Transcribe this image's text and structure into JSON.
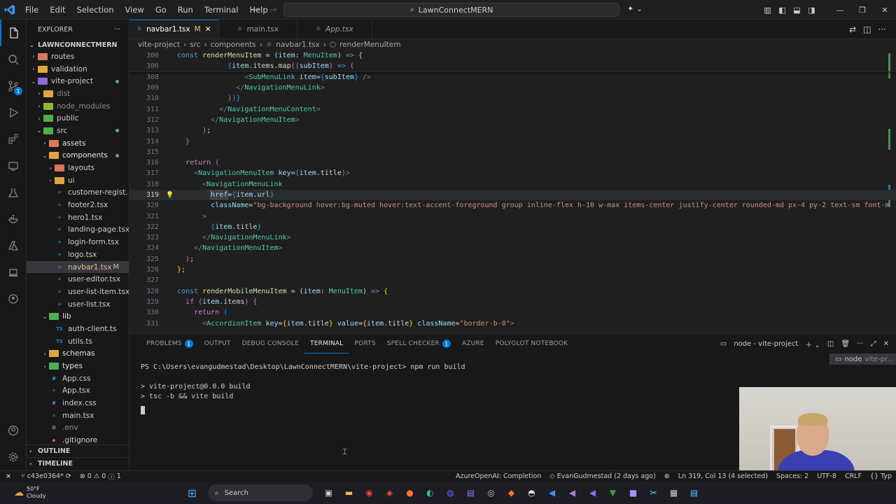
{
  "window": {
    "menu": [
      "File",
      "Edit",
      "Selection",
      "View",
      "Go",
      "Run",
      "Terminal",
      "Help"
    ],
    "search_text": "LawnConnectMERN"
  },
  "explorer": {
    "title": "EXPLORER",
    "root": "LAWNCONNECTMERN",
    "items": [
      {
        "label": "routes",
        "depth": 1,
        "type": "folder",
        "color": "#d9795a",
        "chev": "›"
      },
      {
        "label": "validation",
        "depth": 1,
        "type": "folder",
        "color": "#e0a53d",
        "chev": "›"
      },
      {
        "label": "vite-project",
        "depth": 1,
        "type": "folder",
        "color": "#8b6cdb",
        "chev": "⌄",
        "dot": true
      },
      {
        "label": "dist",
        "depth": 2,
        "type": "folder",
        "color": "#e0a53d",
        "chev": "›",
        "dim": true
      },
      {
        "label": "node_modules",
        "depth": 2,
        "type": "folder",
        "color": "#8fb23a",
        "chev": "›",
        "dim": true
      },
      {
        "label": "public",
        "depth": 2,
        "type": "folder",
        "color": "#4caf50",
        "chev": "›"
      },
      {
        "label": "src",
        "depth": 2,
        "type": "folder",
        "color": "#4caf50",
        "chev": "⌄",
        "dot": true
      },
      {
        "label": "assets",
        "depth": 3,
        "type": "folder",
        "color": "#d9795a",
        "chev": "›"
      },
      {
        "label": "components",
        "depth": 3,
        "type": "folder",
        "color": "#e0a53d",
        "chev": "⌄",
        "dot": true
      },
      {
        "label": "layouts",
        "depth": 4,
        "type": "folder",
        "color": "#d9795a",
        "chev": "›"
      },
      {
        "label": "ui",
        "depth": 4,
        "type": "folder",
        "color": "#e0a53d",
        "chev": "›"
      },
      {
        "label": "customer-regist...",
        "depth": 4,
        "type": "react"
      },
      {
        "label": "footer2.tsx",
        "depth": 4,
        "type": "react"
      },
      {
        "label": "hero1.tsx",
        "depth": 4,
        "type": "react"
      },
      {
        "label": "landing-page.tsx",
        "depth": 4,
        "type": "react"
      },
      {
        "label": "login-form.tsx",
        "depth": 4,
        "type": "react"
      },
      {
        "label": "logo.tsx",
        "depth": 4,
        "type": "react"
      },
      {
        "label": "navbar1.tsx",
        "depth": 4,
        "type": "react",
        "selected": true,
        "mod": "M"
      },
      {
        "label": "user-editor.tsx",
        "depth": 4,
        "type": "react"
      },
      {
        "label": "user-list-item.tsx",
        "depth": 4,
        "type": "react"
      },
      {
        "label": "user-list.tsx",
        "depth": 4,
        "type": "react"
      },
      {
        "label": "lib",
        "depth": 3,
        "type": "folder",
        "color": "#4caf50",
        "chev": "⌄"
      },
      {
        "label": "auth-client.ts",
        "depth": 4,
        "type": "ts"
      },
      {
        "label": "utils.ts",
        "depth": 4,
        "type": "ts"
      },
      {
        "label": "schemas",
        "depth": 3,
        "type": "folder",
        "color": "#e0a53d",
        "chev": "›"
      },
      {
        "label": "types",
        "depth": 3,
        "type": "folder",
        "color": "#4caf50",
        "chev": "›"
      },
      {
        "label": "App.css",
        "depth": 3,
        "type": "css"
      },
      {
        "label": "App.tsx",
        "depth": 3,
        "type": "react"
      },
      {
        "label": "index.css",
        "depth": 3,
        "type": "css"
      },
      {
        "label": "main.tsx",
        "depth": 3,
        "type": "react"
      },
      {
        "label": ".env",
        "depth": 3,
        "type": "env",
        "dim": true
      },
      {
        "label": ".gitignore",
        "depth": 3,
        "type": "git"
      }
    ],
    "sections": [
      "OUTLINE",
      "TIMELINE"
    ]
  },
  "tabs": [
    {
      "label": "navbar1.tsx",
      "suffix": "M",
      "active": true
    },
    {
      "label": "main.tsx"
    },
    {
      "label": "App.tsx",
      "italic": true
    }
  ],
  "breadcrumb": [
    "vite-project",
    "src",
    "components",
    "navbar1.tsx",
    "renderMenuItem"
  ],
  "code": [
    {
      "ln": "300",
      "sticky": true,
      "tokens": [
        [
          "kw",
          "const "
        ],
        [
          "fn",
          "renderMenuItem"
        ],
        [
          "",
          " = ("
        ],
        [
          "attr",
          "item"
        ],
        [
          "",
          ": "
        ],
        [
          "tag",
          "MenuItem"
        ],
        [
          "",
          ") "
        ],
        [
          "kw",
          "=>"
        ],
        [
          "",
          " {"
        ]
      ]
    },
    {
      "ln": "306",
      "sticky": true,
      "tokens": [
        [
          "",
          "            "
        ],
        [
          "br3",
          "{"
        ],
        [
          "attr",
          "item"
        ],
        [
          "",
          ".items."
        ],
        [
          "fn",
          "map"
        ],
        [
          "br2",
          "(("
        ],
        [
          "attr",
          "subItem"
        ],
        [
          "br2",
          ")"
        ],
        [
          "kw",
          " =>"
        ],
        [
          "br2",
          " ("
        ]
      ]
    },
    {
      "ln": "308",
      "tokens": [
        [
          "",
          "                "
        ],
        [
          "pun",
          "<"
        ],
        [
          "tag",
          "SubMenuLink"
        ],
        [
          "attr",
          " item"
        ],
        [
          "",
          "="
        ],
        [
          "br3",
          "{"
        ],
        [
          "attr",
          "subItem"
        ],
        [
          "br3",
          "}"
        ],
        [
          "pun",
          " />"
        ]
      ]
    },
    {
      "ln": "309",
      "tokens": [
        [
          "",
          "              "
        ],
        [
          "pun",
          "</"
        ],
        [
          "tag",
          "NavigationMenuLink"
        ],
        [
          "pun",
          ">"
        ]
      ]
    },
    {
      "ln": "310",
      "tokens": [
        [
          "",
          "            "
        ],
        [
          "br2",
          ")"
        ],
        [
          "br3",
          ")"
        ],
        [
          "br3",
          "}"
        ]
      ]
    },
    {
      "ln": "311",
      "tokens": [
        [
          "",
          "          "
        ],
        [
          "pun",
          "</"
        ],
        [
          "tag",
          "NavigationMenuContent"
        ],
        [
          "pun",
          ">"
        ]
      ]
    },
    {
      "ln": "312",
      "tokens": [
        [
          "",
          "        "
        ],
        [
          "pun",
          "</"
        ],
        [
          "tag",
          "NavigationMenuItem"
        ],
        [
          "pun",
          ">"
        ]
      ]
    },
    {
      "ln": "313",
      "tokens": [
        [
          "",
          "      "
        ],
        [
          "br2",
          ")"
        ],
        [
          "",
          ";"
        ]
      ]
    },
    {
      "ln": "314",
      "tokens": [
        [
          "",
          "  "
        ],
        [
          "br2",
          "}"
        ]
      ]
    },
    {
      "ln": "315",
      "tokens": [
        [
          "",
          ""
        ]
      ]
    },
    {
      "ln": "316",
      "tokens": [
        [
          "",
          "  "
        ],
        [
          "ctl",
          "return"
        ],
        [
          "br2",
          " ("
        ]
      ]
    },
    {
      "ln": "317",
      "tokens": [
        [
          "",
          "    "
        ],
        [
          "pun",
          "<"
        ],
        [
          "tag",
          "NavigationMenuItem"
        ],
        [
          "attr",
          " key"
        ],
        [
          "",
          "="
        ],
        [
          "br3",
          "{"
        ],
        [
          "attr",
          "item"
        ],
        [
          "",
          ".title"
        ],
        [
          "br3",
          "}"
        ],
        [
          "pun",
          ">"
        ]
      ]
    },
    {
      "ln": "318",
      "tokens": [
        [
          "",
          "      "
        ],
        [
          "pun",
          "<"
        ],
        [
          "tag",
          "NavigationMenuLink"
        ]
      ]
    },
    {
      "ln": "319",
      "hl": true,
      "tokens": [
        [
          "",
          "        "
        ],
        [
          "attr",
          "href"
        ],
        [
          "",
          "="
        ],
        [
          "br3",
          "{"
        ],
        [
          "attr",
          "item"
        ],
        [
          "",
          ".url"
        ],
        [
          "br3",
          "}"
        ]
      ]
    },
    {
      "ln": "320",
      "tokens": [
        [
          "",
          "        "
        ],
        [
          "attr",
          "className"
        ],
        [
          "",
          "="
        ],
        [
          "str",
          "\"bg-background hover:bg-muted hover:text-accent-foreground group inline-flex h-10 w-max items-center justify-center rounded-md px-4 py-2 text-sm font-m"
        ]
      ]
    },
    {
      "ln": "321",
      "tokens": [
        [
          "",
          "      "
        ],
        [
          "pun",
          ">"
        ]
      ]
    },
    {
      "ln": "322",
      "tokens": [
        [
          "",
          "        "
        ],
        [
          "br3",
          "{"
        ],
        [
          "attr",
          "item"
        ],
        [
          "",
          ".title"
        ],
        [
          "br3",
          "}"
        ]
      ]
    },
    {
      "ln": "323",
      "tokens": [
        [
          "",
          "      "
        ],
        [
          "pun",
          "</"
        ],
        [
          "tag",
          "NavigationMenuLink"
        ],
        [
          "pun",
          ">"
        ]
      ]
    },
    {
      "ln": "324",
      "tokens": [
        [
          "",
          "    "
        ],
        [
          "pun",
          "</"
        ],
        [
          "tag",
          "NavigationMenuItem"
        ],
        [
          "pun",
          ">"
        ]
      ]
    },
    {
      "ln": "325",
      "tokens": [
        [
          "",
          "  "
        ],
        [
          "br2",
          ")"
        ],
        [
          "",
          ";"
        ]
      ]
    },
    {
      "ln": "326",
      "tokens": [
        [
          "br",
          "}"
        ],
        [
          "",
          ";"
        ]
      ]
    },
    {
      "ln": "327",
      "tokens": [
        [
          "",
          ""
        ]
      ]
    },
    {
      "ln": "328",
      "tokens": [
        [
          "kw",
          "const "
        ],
        [
          "fn",
          "renderMobileMenuItem"
        ],
        [
          "",
          " = ("
        ],
        [
          "attr",
          "item"
        ],
        [
          "",
          ": "
        ],
        [
          "tag",
          "MenuItem"
        ],
        [
          "",
          ") "
        ],
        [
          "kw",
          "=>"
        ],
        [
          "",
          " "
        ],
        [
          "br",
          "{"
        ]
      ]
    },
    {
      "ln": "329",
      "tokens": [
        [
          "",
          "  "
        ],
        [
          "ctl",
          "if"
        ],
        [
          "br2",
          " ("
        ],
        [
          "attr",
          "item"
        ],
        [
          "",
          ".items"
        ],
        [
          "br2",
          ")"
        ],
        [
          "",
          " "
        ],
        [
          "br2",
          "{"
        ]
      ]
    },
    {
      "ln": "330",
      "tokens": [
        [
          "",
          "    "
        ],
        [
          "ctl",
          "return"
        ],
        [
          "br3",
          " ("
        ]
      ]
    },
    {
      "ln": "331",
      "tokens": [
        [
          "",
          "      "
        ],
        [
          "pun",
          "<"
        ],
        [
          "tag",
          "AccordionItem"
        ],
        [
          "attr",
          " key"
        ],
        [
          "",
          "="
        ],
        [
          "br",
          "{"
        ],
        [
          "attr",
          "item"
        ],
        [
          "",
          ".title"
        ],
        [
          "br",
          "}"
        ],
        [
          "attr",
          " value"
        ],
        [
          "",
          "="
        ],
        [
          "br",
          "{"
        ],
        [
          "attr",
          "item"
        ],
        [
          "",
          ".title"
        ],
        [
          "br",
          "}"
        ],
        [
          "attr",
          " className"
        ],
        [
          "",
          "="
        ],
        [
          "str",
          "\"border-b-0\""
        ],
        [
          "pun",
          ">"
        ]
      ]
    }
  ],
  "panel": {
    "tabs": [
      {
        "label": "PROBLEMS",
        "badge": "1"
      },
      {
        "label": "OUTPUT"
      },
      {
        "label": "DEBUG CONSOLE"
      },
      {
        "label": "TERMINAL",
        "active": true
      },
      {
        "label": "PORTS"
      },
      {
        "label": "SPELL CHECKER",
        "badge": "1"
      },
      {
        "label": "AZURE"
      },
      {
        "label": "POLYGLOT NOTEBOOK"
      }
    ],
    "terminal_name": "node - vite-project",
    "terminal_list_item": "node",
    "terminal_list_sub": "vite-pr...",
    "lines": [
      "PS C:\\Users\\evangudmestad\\Desktop\\LawnConnectMERN\\vite-project> npm run build",
      "",
      "> vite-project@0.0.0 build",
      "> tsc -b && vite build"
    ]
  },
  "status": {
    "branch": "c43e0364*",
    "errors": "0",
    "warnings": "0",
    "info": "1",
    "completion": "AzureOpenAI: Completion",
    "blame": "EvanGudmestad (2 days ago)",
    "position": "Ln 319, Col 13 (4 selected)",
    "spaces": "Spaces: 2",
    "encoding": "UTF-8",
    "eol": "CRLF",
    "lang": "Typ"
  },
  "taskbar": {
    "temp": "50°F",
    "weather": "Cloudy",
    "search": "Search"
  }
}
